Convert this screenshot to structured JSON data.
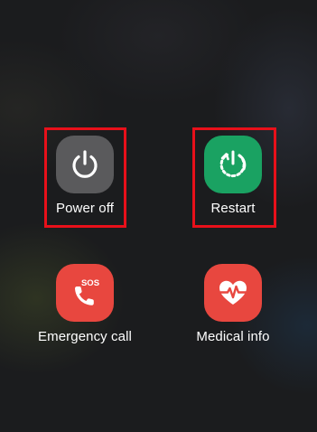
{
  "power_menu": {
    "power_off": {
      "label": "Power off",
      "icon": "power-icon",
      "color": "#5a5a5c"
    },
    "restart": {
      "label": "Restart",
      "icon": "restart-icon",
      "color": "#1aa262"
    },
    "emergency_call": {
      "label": "Emergency call",
      "icon": "sos-phone-icon",
      "badge": "SOS",
      "color": "#e8473f"
    },
    "medical_info": {
      "label": "Medical info",
      "icon": "heart-pulse-icon",
      "color": "#e8473f"
    }
  },
  "highlight_color": "#e8101a"
}
